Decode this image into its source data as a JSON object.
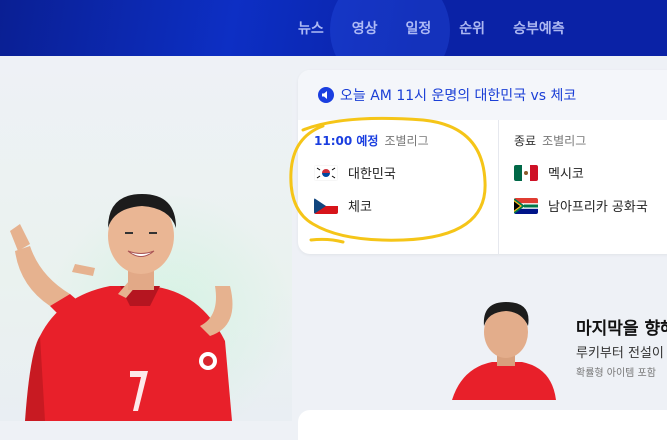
{
  "nav": {
    "items": [
      {
        "label": "뉴스"
      },
      {
        "label": "영상"
      },
      {
        "label": "일정"
      },
      {
        "label": "순위"
      },
      {
        "label": "승부예측"
      }
    ]
  },
  "notice": {
    "icon": "speaker-icon",
    "text": "오늘 AM 11시 운명의 대한민국 vs 체코"
  },
  "matches": [
    {
      "status": "11:00 예정",
      "league": "조별리그",
      "teams": [
        {
          "name": "대한민국",
          "flag": "korea-flag-icon"
        },
        {
          "name": "체코",
          "flag": "czech-flag-icon"
        }
      ]
    },
    {
      "status": "종료",
      "league": "조별리그",
      "teams": [
        {
          "name": "멕시코",
          "flag": "mexico-flag-icon"
        },
        {
          "name": "남아프리카 공화국",
          "flag": "south-africa-flag-icon"
        }
      ]
    }
  ],
  "promo": {
    "title": "마지막을 향해",
    "subtitle": "루키부터 전설이",
    "note": "확률형 아이템 포함"
  },
  "colors": {
    "nav_bg": "#0a22a6",
    "accent": "#1a3ee0",
    "highlight": "#f5c518"
  }
}
